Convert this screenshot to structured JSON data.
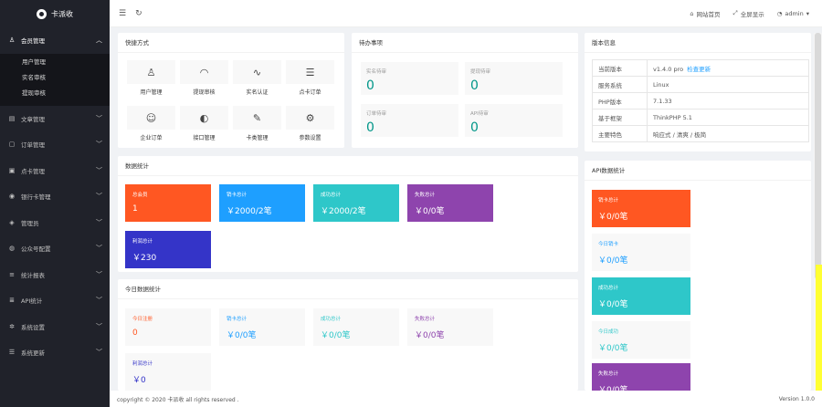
{
  "app": {
    "title": "卡派收"
  },
  "sidebar": {
    "items": [
      {
        "label": "会员管理",
        "icon": "user-icon",
        "sub": [
          {
            "label": "用户管理"
          },
          {
            "label": "实名审核"
          },
          {
            "label": "提现审核"
          }
        ]
      },
      {
        "label": "文章管理",
        "icon": "document-icon"
      },
      {
        "label": "订单管理",
        "icon": "order-icon"
      },
      {
        "label": "点卡管理",
        "icon": "card-icon"
      },
      {
        "label": "银行卡管理",
        "icon": "bank-card-icon"
      },
      {
        "label": "管理员",
        "icon": "admin-icon"
      },
      {
        "label": "公众号配置",
        "icon": "wechat-icon"
      },
      {
        "label": "统计报表",
        "icon": "report-icon"
      },
      {
        "label": "API统计",
        "icon": "api-icon"
      },
      {
        "label": "系统设置",
        "icon": "settings-icon"
      },
      {
        "label": "系统更新",
        "icon": "update-icon"
      }
    ]
  },
  "header": {
    "links": [
      {
        "label": "网站首页",
        "icon": "home-icon"
      },
      {
        "label": "全屏显示",
        "icon": "fullscreen-icon"
      },
      {
        "label": "admin",
        "icon": "avatar-icon"
      }
    ]
  },
  "shortcuts": {
    "title": "快捷方式",
    "items": [
      {
        "label": "用户管理",
        "icon": "user-icon"
      },
      {
        "label": "提现审核",
        "icon": "dashboard-icon"
      },
      {
        "label": "实名认证",
        "icon": "pulse-icon"
      },
      {
        "label": "点卡订单",
        "icon": "stack-icon"
      },
      {
        "label": "企业订单",
        "icon": "smile-icon"
      },
      {
        "label": "接口管理",
        "icon": "compass-icon"
      },
      {
        "label": "卡类管理",
        "icon": "edit-icon"
      },
      {
        "label": "参数设置",
        "icon": "gear-icon"
      }
    ]
  },
  "todo": {
    "title": "待办事项",
    "items": [
      {
        "label": "实名待审",
        "value": "0"
      },
      {
        "label": "提现待审",
        "value": "0"
      },
      {
        "label": "订单待审",
        "value": "0"
      },
      {
        "label": "API待审",
        "value": "0"
      }
    ]
  },
  "version": {
    "title": "版本信息",
    "rows": [
      {
        "key": "当前版本",
        "value": "v1.4.0 pro",
        "link": "检查更新"
      },
      {
        "key": "服务系统",
        "value": "Linux"
      },
      {
        "key": "PHP版本",
        "value": "7.1.33"
      },
      {
        "key": "基于框架",
        "value": "ThinkPHP 5.1"
      },
      {
        "key": "主要特色",
        "value": "响应式 / 清爽 / 极简"
      }
    ]
  },
  "stats": {
    "title": "数据统计",
    "tiles": [
      {
        "label": "总会员",
        "value": "1",
        "color": "#ff5722"
      },
      {
        "label": "销卡总计",
        "value": "￥2000/2笔",
        "color": "#1e9fff"
      },
      {
        "label": "成功总计",
        "value": "￥2000/2笔",
        "color": "#2ec7c9"
      },
      {
        "label": "失败总计",
        "value": "￥0/0笔",
        "color": "#8e44ad"
      },
      {
        "label": "利润总计",
        "value": "￥230",
        "color": "#3434c8"
      }
    ]
  },
  "today": {
    "title": "今日数据统计",
    "tiles": [
      {
        "label": "今日注册",
        "value": "0",
        "color": "#ff5722"
      },
      {
        "label": "销卡总计",
        "value": "￥0/0笔",
        "color": "#1e9fff"
      },
      {
        "label": "成功总计",
        "value": "￥0/0笔",
        "color": "#2ec7c9"
      },
      {
        "label": "失败总计",
        "value": "￥0/0笔",
        "color": "#8e44ad"
      },
      {
        "label": "利润总计",
        "value": "￥0",
        "color": "#3434c8"
      }
    ]
  },
  "api": {
    "title": "API数据统计",
    "tiles": [
      {
        "label": "销卡总计",
        "value": "￥0/0笔",
        "style": "colored",
        "color": "#ff5722"
      },
      {
        "label": "今日销卡",
        "value": "￥0/0笔",
        "style": "plain",
        "color": "#1e9fff"
      },
      {
        "label": "成功总计",
        "value": "￥0/0笔",
        "style": "colored",
        "color": "#2ec7c9"
      },
      {
        "label": "今日成功",
        "value": "￥0/0笔",
        "style": "plain",
        "color": "#2ec7c9"
      },
      {
        "label": "失败总计",
        "value": "￥0/0笔",
        "style": "colored",
        "color": "#8e44ad"
      }
    ]
  },
  "footer": {
    "copyright": "copyright © 2020 卡派收 all rights reserved .",
    "version": "Version 1.0.0"
  }
}
